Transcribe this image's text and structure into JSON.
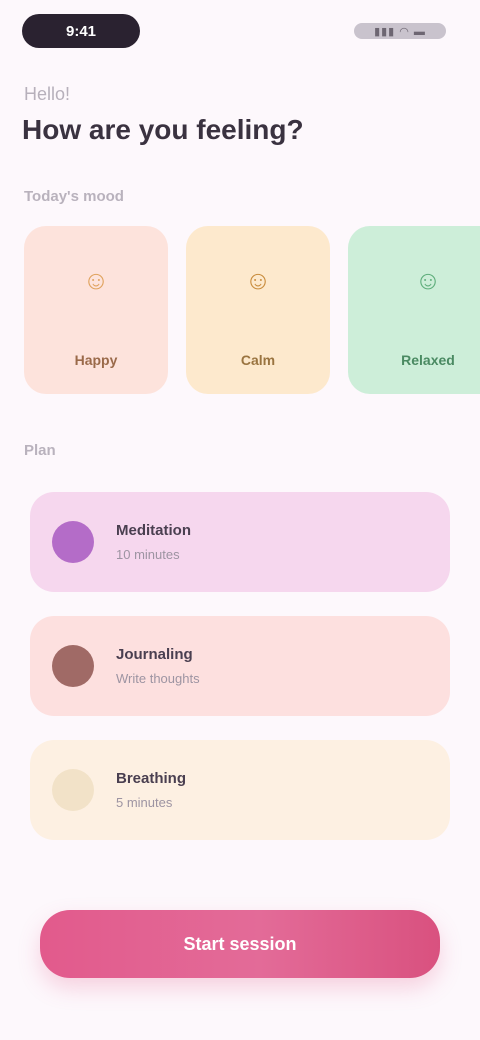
{
  "status_bar": {
    "time": "9:41",
    "icons": "▮▮▮ ◠ ▬"
  },
  "header": {
    "greeting": "Hello!",
    "title": "How are you feeling?"
  },
  "mood_section": {
    "label": "Today's mood",
    "cards": [
      {
        "label": "Happy",
        "icon": "happy-face-icon",
        "glyph": "☺",
        "bg": "#fde3dc",
        "icon_color": "#e0a35f",
        "text_color": "#9a6a4a"
      },
      {
        "label": "Calm",
        "icon": "calm-face-icon",
        "glyph": "☺",
        "bg": "#fde9cd",
        "icon_color": "#c98d3e",
        "text_color": "#9a7440"
      },
      {
        "label": "Relaxed",
        "icon": "relaxed-face-icon",
        "glyph": "☺",
        "bg": "#cdeed9",
        "icon_color": "#5fae7c",
        "text_color": "#4a8a62"
      }
    ]
  },
  "tasks_section": {
    "label": "Plan",
    "items": [
      {
        "title": "Meditation",
        "subtitle": "10 minutes",
        "icon": "meditation-icon",
        "glyph": "●",
        "bg": "#f6d7ee",
        "bullet": "#b46cc8"
      },
      {
        "title": "Journaling",
        "subtitle": "Write thoughts",
        "icon": "journal-icon",
        "glyph": "●",
        "bg": "#fde0df",
        "bullet": "#a06a66"
      },
      {
        "title": "Breathing",
        "subtitle": "5 minutes",
        "icon": "breathing-icon",
        "glyph": "○",
        "bg": "#fdf0e2",
        "bullet": "#f2e2c8"
      }
    ]
  },
  "cta": {
    "label": "Start session"
  }
}
